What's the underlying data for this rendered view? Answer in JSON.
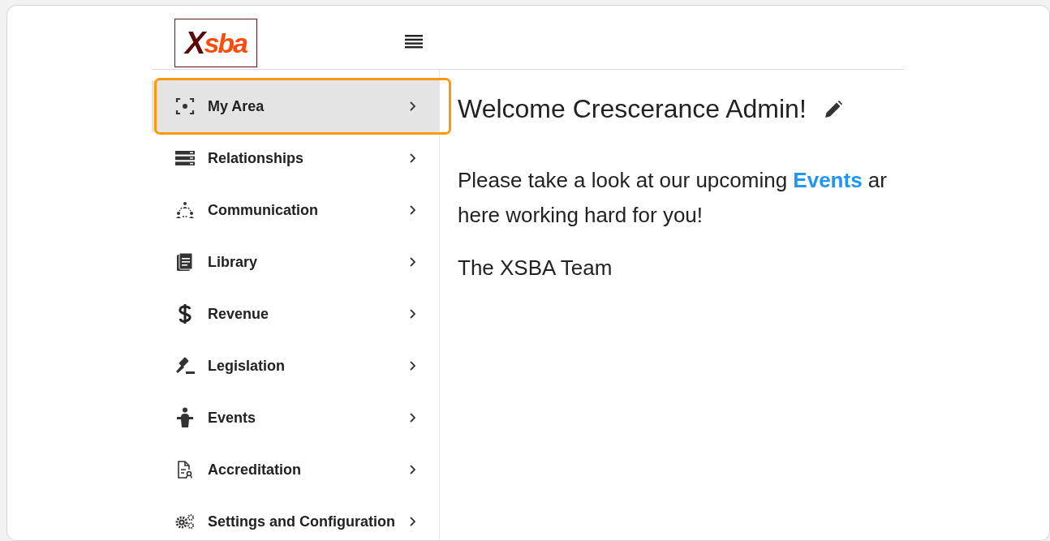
{
  "logo": {
    "mark": "X",
    "rest": "sba"
  },
  "sidebar": {
    "items": [
      {
        "label": "My Area",
        "selected": true,
        "highlighted": true
      },
      {
        "label": "Relationships",
        "selected": false,
        "highlighted": false
      },
      {
        "label": "Communication",
        "selected": false,
        "highlighted": false
      },
      {
        "label": "Library",
        "selected": false,
        "highlighted": false
      },
      {
        "label": "Revenue",
        "selected": false,
        "highlighted": false
      },
      {
        "label": "Legislation",
        "selected": false,
        "highlighted": false
      },
      {
        "label": "Events",
        "selected": false,
        "highlighted": false
      },
      {
        "label": "Accreditation",
        "selected": false,
        "highlighted": false
      },
      {
        "label": "Settings and Configuration",
        "selected": false,
        "highlighted": false
      }
    ]
  },
  "main": {
    "heading": "Welcome Crescerance Admin!",
    "message": {
      "before": "Please take a look at our upcoming ",
      "link": "Events",
      "after": " ar",
      "line2": "here working hard for you!"
    },
    "signature": "The XSBA Team"
  }
}
